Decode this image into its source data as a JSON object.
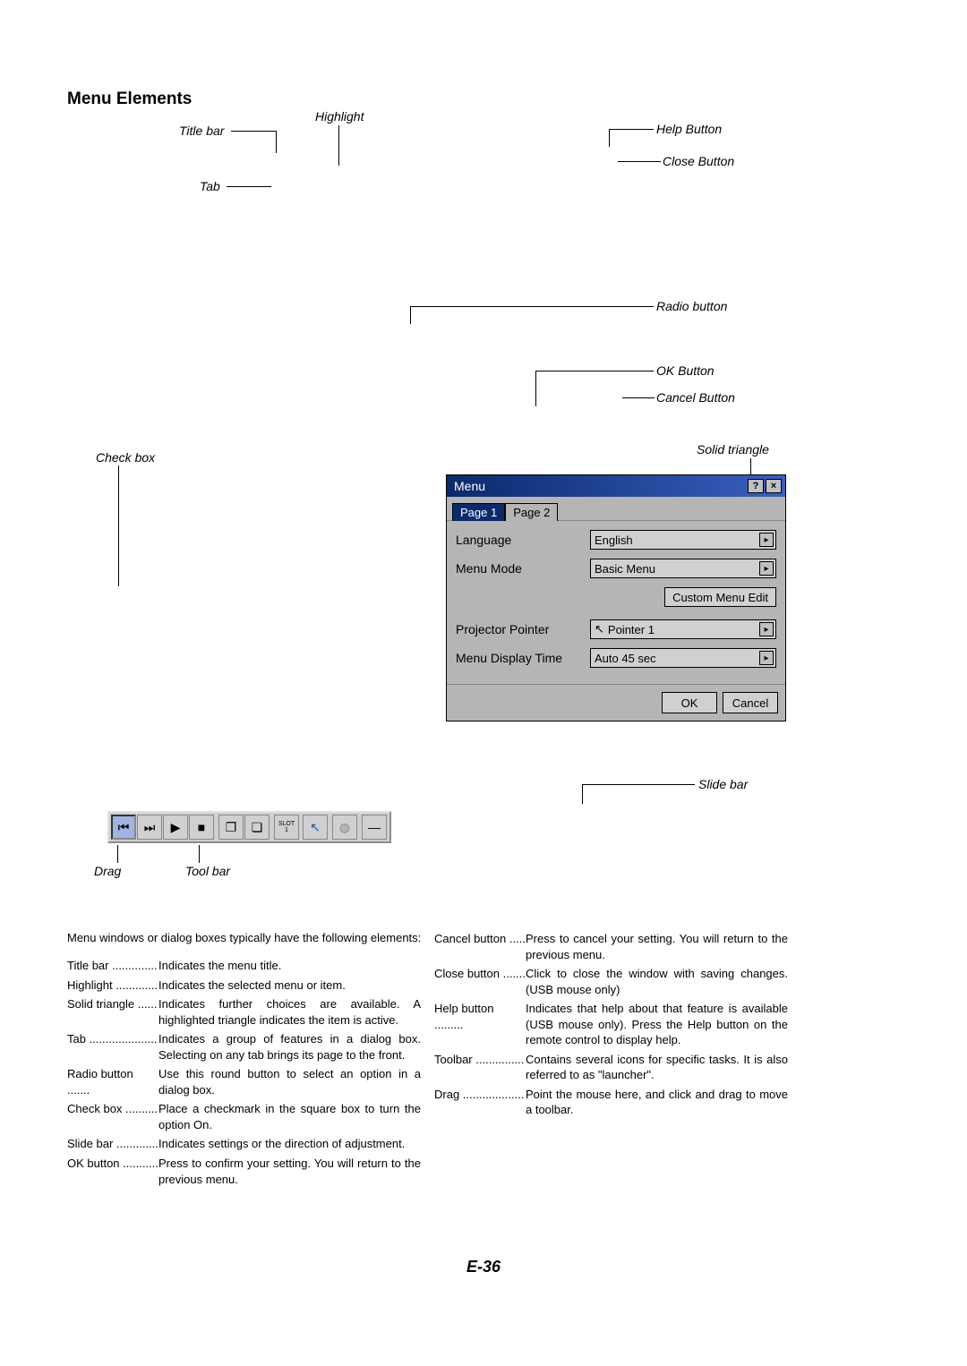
{
  "heading": "Menu Elements",
  "callouts": {
    "title_bar": "Title bar",
    "highlight": "Highlight",
    "tab": "Tab",
    "help_button": "Help Button",
    "close_button": "Close Button",
    "radio_button": "Radio button",
    "ok_button": "OK Button",
    "cancel_button": "Cancel Button",
    "check_box": "Check box",
    "solid_triangle": "Solid triangle",
    "slide_bar": "Slide bar",
    "drag": "Drag",
    "tool_bar": "Tool bar"
  },
  "dialog": {
    "title": "Menu",
    "help_glyph": "?",
    "close_glyph": "×",
    "tabs": {
      "page1": "Page 1",
      "page2": "Page 2"
    },
    "fields": {
      "language_label": "Language",
      "language_value": "English",
      "menu_mode_label": "Menu Mode",
      "menu_mode_value": "Basic Menu",
      "custom_edit": "Custom Menu Edit",
      "pointer_label": "Projector Pointer",
      "pointer_value": "Pointer 1",
      "display_time_label": "Menu Display Time",
      "display_time_value": "Auto 45 sec"
    },
    "buttons": {
      "ok": "OK",
      "cancel": "Cancel"
    },
    "arrow": "▸",
    "pointer_icon": "↖"
  },
  "toolbar_icons": {
    "prev": "⏮",
    "next": "⏭",
    "play": "▶",
    "stop": "■",
    "window": "❐",
    "copy": "❏",
    "slot_top": "SLOT",
    "slot_bottom": "1",
    "cursor": "↖",
    "globe": "◍",
    "minus": "—"
  },
  "intro": "Menu windows or dialog boxes typically have the following elements:",
  "defs_left": [
    {
      "term": "Title bar",
      "dots": "..............",
      "desc": "Indicates the menu title."
    },
    {
      "term": "Highlight",
      "dots": ".............",
      "desc": "Indicates the selected menu or item."
    },
    {
      "term": "Solid triangle",
      "dots": "......",
      "desc": "Indicates further choices are available. A highlighted triangle indicates the item is active."
    },
    {
      "term": "Tab",
      "dots": ".....................",
      "desc": "Indicates a group of features in a dialog box. Selecting on any tab brings its page to the front."
    },
    {
      "term": "Radio button",
      "dots": ".......",
      "desc": "Use this round button to select an option in a dialog box."
    },
    {
      "term": "Check box",
      "dots": "..........",
      "desc": "Place a checkmark in the square box to turn the option On."
    },
    {
      "term": "Slide bar",
      "dots": ".............",
      "desc": "Indicates settings or the direction of adjustment."
    },
    {
      "term": "OK button",
      "dots": "...........",
      "desc": "Press to confirm your setting. You will return to the previous menu."
    }
  ],
  "defs_right": [
    {
      "term": "Cancel button",
      "dots": ".....",
      "desc": "Press to cancel your setting. You will return to the previous menu."
    },
    {
      "term": "Close button",
      "dots": ".......",
      "desc": "Click to close the window with saving changes. (USB mouse only)"
    },
    {
      "term": "Help button",
      "dots": ".........",
      "desc": "Indicates that help about that feature is available (USB mouse only). Press the Help button on the remote control to display help."
    },
    {
      "term": "Toolbar",
      "dots": "...............",
      "desc": "Contains several icons for specific tasks. It is also referred to as \"launcher\"."
    },
    {
      "term": "Drag",
      "dots": "...................",
      "desc": "Point the mouse here, and click and drag to move a toolbar."
    }
  ],
  "page_number": "E-36"
}
